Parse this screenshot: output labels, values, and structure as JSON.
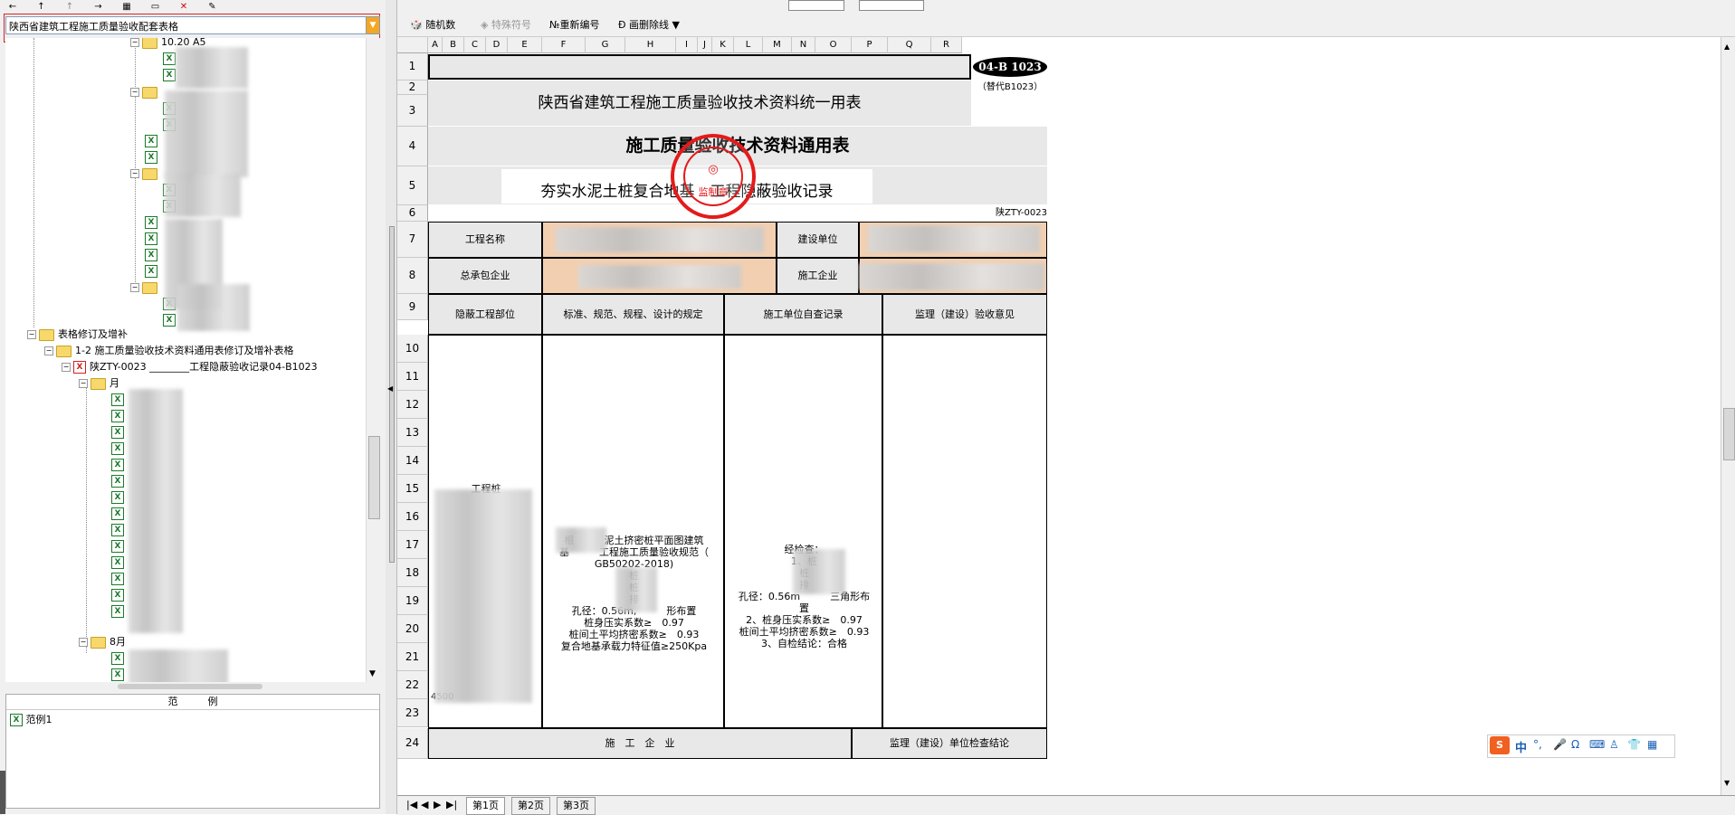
{
  "left_panel": {
    "toolbar_icons": [
      "back-arrow-icon",
      "up-arrow-icon",
      "move-up-icon",
      "forward-arrow-icon",
      "copy-table-icon",
      "paste-icon",
      "delete-icon",
      "edit-icon"
    ],
    "combo_value": "陕西省建筑工程施工质量验收配套表格",
    "tree": {
      "n1_label": "10.20 A5",
      "n2_label": "表格修订及增补",
      "n3_label": "1-2  施工质量验收技术资料通用表修订及增补表格",
      "n4_label": "陕ZTY-0023 ________工程隐蔽验收记录04-B1023",
      "n5_label": "月",
      "n6_label": "8月"
    },
    "legend_title": "范　　　例",
    "legend_item": "范例1"
  },
  "toolbar2": {
    "random_label": "随机数",
    "special_label": "特殊符号",
    "renumber_label": "重新编号",
    "slash_label": "画删除线"
  },
  "sheet": {
    "columns": [
      "A",
      "B",
      "C",
      "D",
      "E",
      "F",
      "G",
      "H",
      "I",
      "J",
      "K",
      "L",
      "M",
      "N",
      "O",
      "P",
      "Q",
      "R"
    ],
    "rows": [
      "1",
      "2",
      "3",
      "4",
      "5",
      "6",
      "7",
      "8",
      "9",
      "10",
      "11",
      "12",
      "13",
      "14",
      "15",
      "16",
      "17",
      "18",
      "19",
      "20",
      "21",
      "22",
      "23",
      "24"
    ],
    "badge": "04-B 1023",
    "replaces": "（替代B1023）",
    "title1": "陕西省建筑工程施工质量验收技术资料统一用表",
    "title2": "施工质量验收技术资料通用表",
    "title3": "夯实水泥土桩复合地基　工程隐蔽验收记录",
    "doc_code": "陕ZTY-0023",
    "project_name_label": "工程名称",
    "builder_label": "建设单位",
    "general_contractor_label": "总承包企业",
    "construction_company_label": "施工企业",
    "hidden_part_label": "隐蔽工程部位",
    "standard_label": "标准、规范、规程、设计的规定",
    "self_check_label": "施工单位自查记录",
    "supervision_label": "监理（建设）验收意见",
    "c_part_1": "工程桩",
    "c_part_2": "4500",
    "std_lines": [
      "根　　　泥土挤密桩平面图建筑",
      "基　　　工程施工质量验收规范（",
      "GB50202-2018)",
      "桩",
      "桩　　",
      "排",
      "孔径：0.56m,　　　形布置",
      "桩身压实系数≥　0.97",
      "桩间土平均挤密系数≥　0.93",
      "复合地基承载力特征值≥250Kpa"
    ],
    "self_lines": [
      "经检查：",
      "1、桩　　",
      "桩",
      "排　",
      "孔径：0.56m　　　三角形布",
      "置",
      "2、桩身压实系数≥　0.97",
      "桩间土平均挤密系数≥　0.93",
      "3、自检结论：合格"
    ],
    "row24_left": "施　工　企　业",
    "row24_right": "监理（建设）单位检查结论",
    "stamp_text": "监制章"
  },
  "tabs": [
    "第1页",
    "第2页",
    "第3页"
  ],
  "ime": {
    "logo": "S",
    "lang": "中"
  }
}
